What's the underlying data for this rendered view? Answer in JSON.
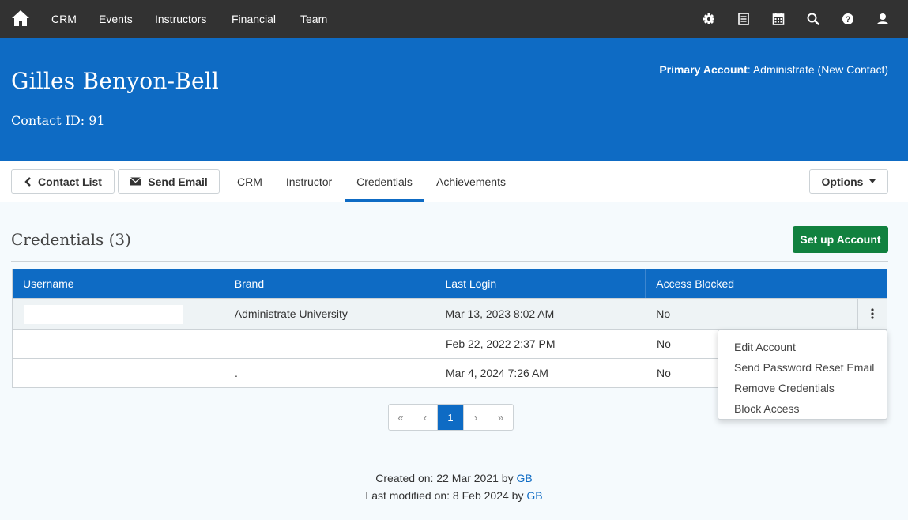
{
  "topnav": {
    "links": [
      "CRM",
      "Events",
      "Instructors",
      "Financial",
      "Team"
    ],
    "icons": [
      "gear-icon",
      "document-icon",
      "calendar-icon",
      "search-icon",
      "help-icon",
      "user-icon"
    ]
  },
  "header": {
    "name": "Gilles Benyon-Bell",
    "contact_id": "Contact ID: 91",
    "primary_account_label": "Primary Account",
    "primary_account_value": ": Administrate (New Contact)"
  },
  "tabbar": {
    "contact_list": "Contact List",
    "send_email": "Send Email",
    "tabs": [
      "CRM",
      "Instructor",
      "Credentials",
      "Achievements"
    ],
    "active_tab": "Credentials",
    "options": "Options"
  },
  "section": {
    "title": "Credentials (3)",
    "setup_button": "Set up Account"
  },
  "table": {
    "headers": [
      "Username",
      "Brand",
      "Last Login",
      "Access Blocked"
    ],
    "rows": [
      {
        "username": "",
        "brand": "Administrate University",
        "last_login": "Mar 13, 2023 8:02 AM",
        "blocked": "No"
      },
      {
        "username": "",
        "brand": "",
        "last_login": "Feb 22, 2022 2:37 PM",
        "blocked": "No"
      },
      {
        "username": "",
        "brand": ".",
        "last_login": "Mar 4, 2024 7:26 AM",
        "blocked": "No"
      }
    ]
  },
  "dropdown": {
    "items": [
      "Edit Account",
      "Send Password Reset Email",
      "Remove Credentials",
      "Block Access"
    ]
  },
  "pagination": {
    "first": "«",
    "prev": "‹",
    "current": "1",
    "next": "›",
    "last": "»"
  },
  "footer": {
    "created_prefix": "Created on: 22 Mar 2021 by ",
    "created_by": "GB",
    "modified_prefix": "Last modified on: 8 Feb 2024 by ",
    "modified_by": "GB"
  },
  "colors": {
    "nav_bg": "#323232",
    "brand_blue": "#0e6bc4",
    "green": "#11813f"
  }
}
